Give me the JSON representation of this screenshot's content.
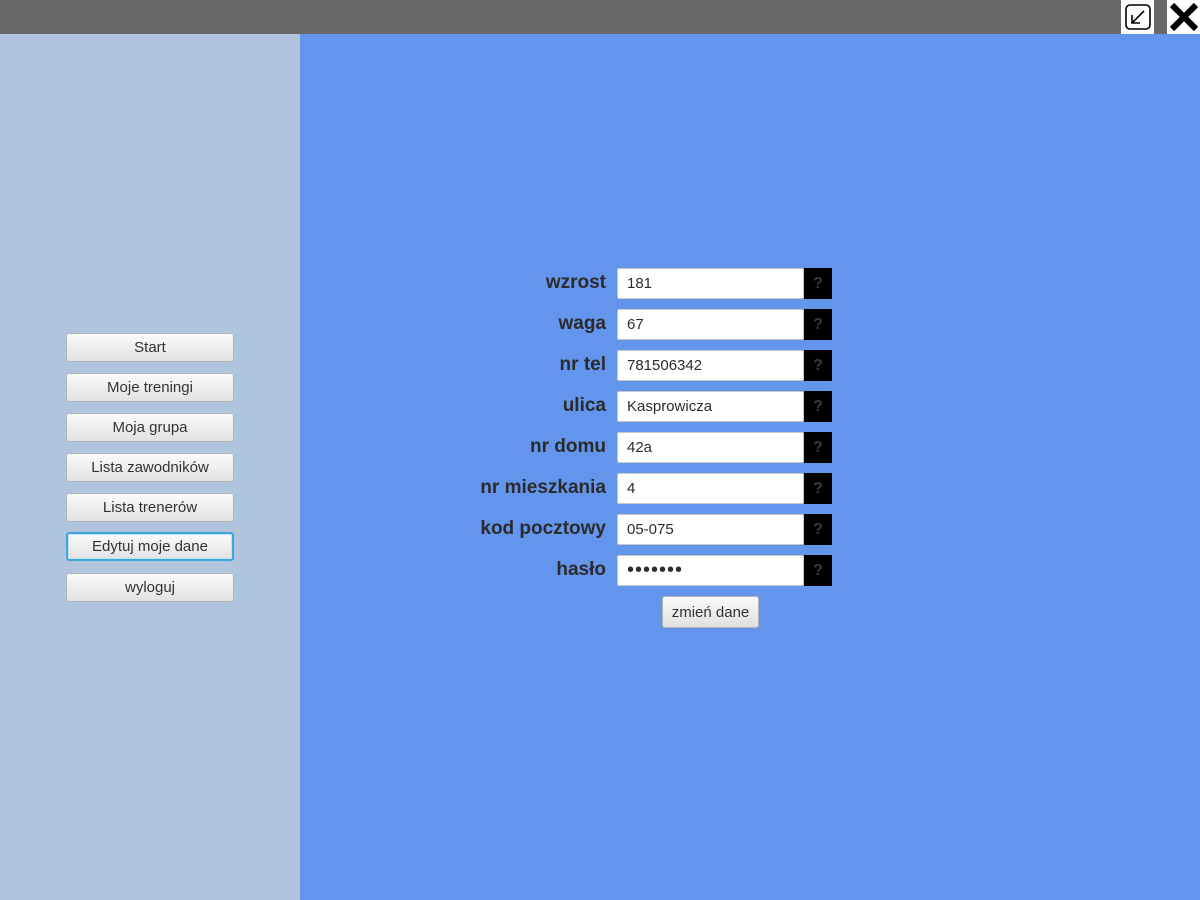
{
  "titlebar": {
    "minimize_icon": "minimize-arrow-icon",
    "close_icon": "close-x-icon",
    "color": "#686868"
  },
  "sidebar": {
    "background": "#b0c4de",
    "items": [
      {
        "label": "Start"
      },
      {
        "label": "Moje treningi"
      },
      {
        "label": "Moja grupa"
      },
      {
        "label": "Lista zawodników"
      },
      {
        "label": "Lista trenerów"
      },
      {
        "label": "Edytuj moje dane",
        "focused": true
      },
      {
        "label": "wyloguj"
      }
    ]
  },
  "main": {
    "background": "#6495ed"
  },
  "form": {
    "fields": [
      {
        "label": "wzrost",
        "value": "181"
      },
      {
        "label": "waga",
        "value": "67"
      },
      {
        "label": "nr tel",
        "value": "781506342"
      },
      {
        "label": "ulica",
        "value": "Kasprowicza"
      },
      {
        "label": "nr domu",
        "value": "42a"
      },
      {
        "label": "nr mieszkania",
        "value": "4"
      },
      {
        "label": "kod pocztowy",
        "value": "05-075"
      },
      {
        "label": "hasło",
        "value": "•••••••",
        "type": "password"
      }
    ],
    "help_label": "?",
    "submit_label": "zmień dane"
  }
}
